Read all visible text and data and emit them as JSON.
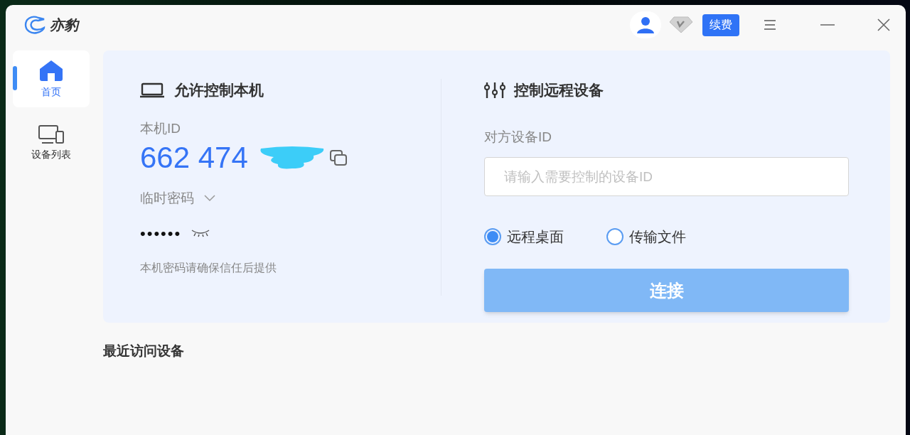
{
  "app": {
    "name": "亦豹"
  },
  "header": {
    "renew_button": "续费"
  },
  "sidebar": {
    "items": [
      {
        "label": "首页",
        "kind": "home",
        "selected": true
      },
      {
        "label": "设备列表",
        "kind": "devices",
        "selected": false
      }
    ]
  },
  "local": {
    "title": "允许控制本机",
    "id_label": "本机ID",
    "id_value": "662 474",
    "password_label": "临时密码",
    "password": "••••••",
    "hint": "本机密码请确保信任后提供"
  },
  "remote": {
    "title": "控制远程设备",
    "id_label": "对方设备ID",
    "placeholder": "请输入需要控制的设备ID",
    "modes": [
      {
        "label": "远程桌面",
        "selected": true
      },
      {
        "label": "传输文件",
        "selected": false
      }
    ],
    "connect_button": {
      "label": "连接",
      "disabled": true
    }
  },
  "recent": {
    "title": "最近访问设备"
  }
}
